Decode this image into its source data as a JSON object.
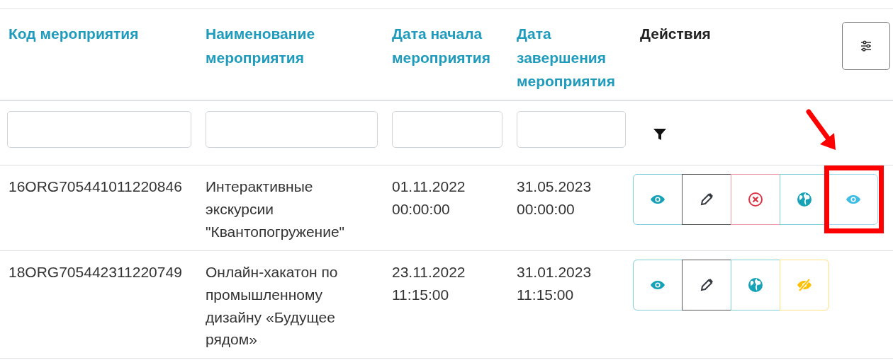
{
  "table": {
    "columns": [
      {
        "label": "Код мероприятия"
      },
      {
        "label": "Наименование мероприятия"
      },
      {
        "label": "Дата начала мероприятия"
      },
      {
        "label": "Дата завершения мероприятия"
      },
      {
        "label": "Действия",
        "kind": "actions"
      }
    ],
    "filters": [
      {
        "kind": "text"
      },
      {
        "kind": "text"
      },
      {
        "kind": "text"
      },
      {
        "kind": "text"
      },
      {
        "kind": "icon"
      }
    ],
    "rows": [
      {
        "code": "16ORG705441011220846",
        "name": "Интерактивные экскурсии \"Квантопогружение\"",
        "start": "01.11.2022 00:00:00",
        "end": "31.05.2023 00:00:00",
        "actions": [
          {
            "kind": "view",
            "highlighted": false
          },
          {
            "kind": "edit",
            "highlighted": false
          },
          {
            "kind": "delete",
            "highlighted": false
          },
          {
            "kind": "publish",
            "highlighted": false
          },
          {
            "kind": "view-alt",
            "highlighted": true
          }
        ]
      },
      {
        "code": "18ORG705442311220749",
        "name": "Онлайн-хакатон по промышленному дизайну «Будущее рядом»",
        "start": "23.11.2022 11:15:00",
        "end": "31.01.2023 11:15:00",
        "actions": [
          {
            "kind": "view",
            "highlighted": false
          },
          {
            "kind": "edit",
            "highlighted": false
          },
          {
            "kind": "publish",
            "highlighted": false
          },
          {
            "kind": "hide",
            "highlighted": false
          }
        ]
      }
    ]
  }
}
